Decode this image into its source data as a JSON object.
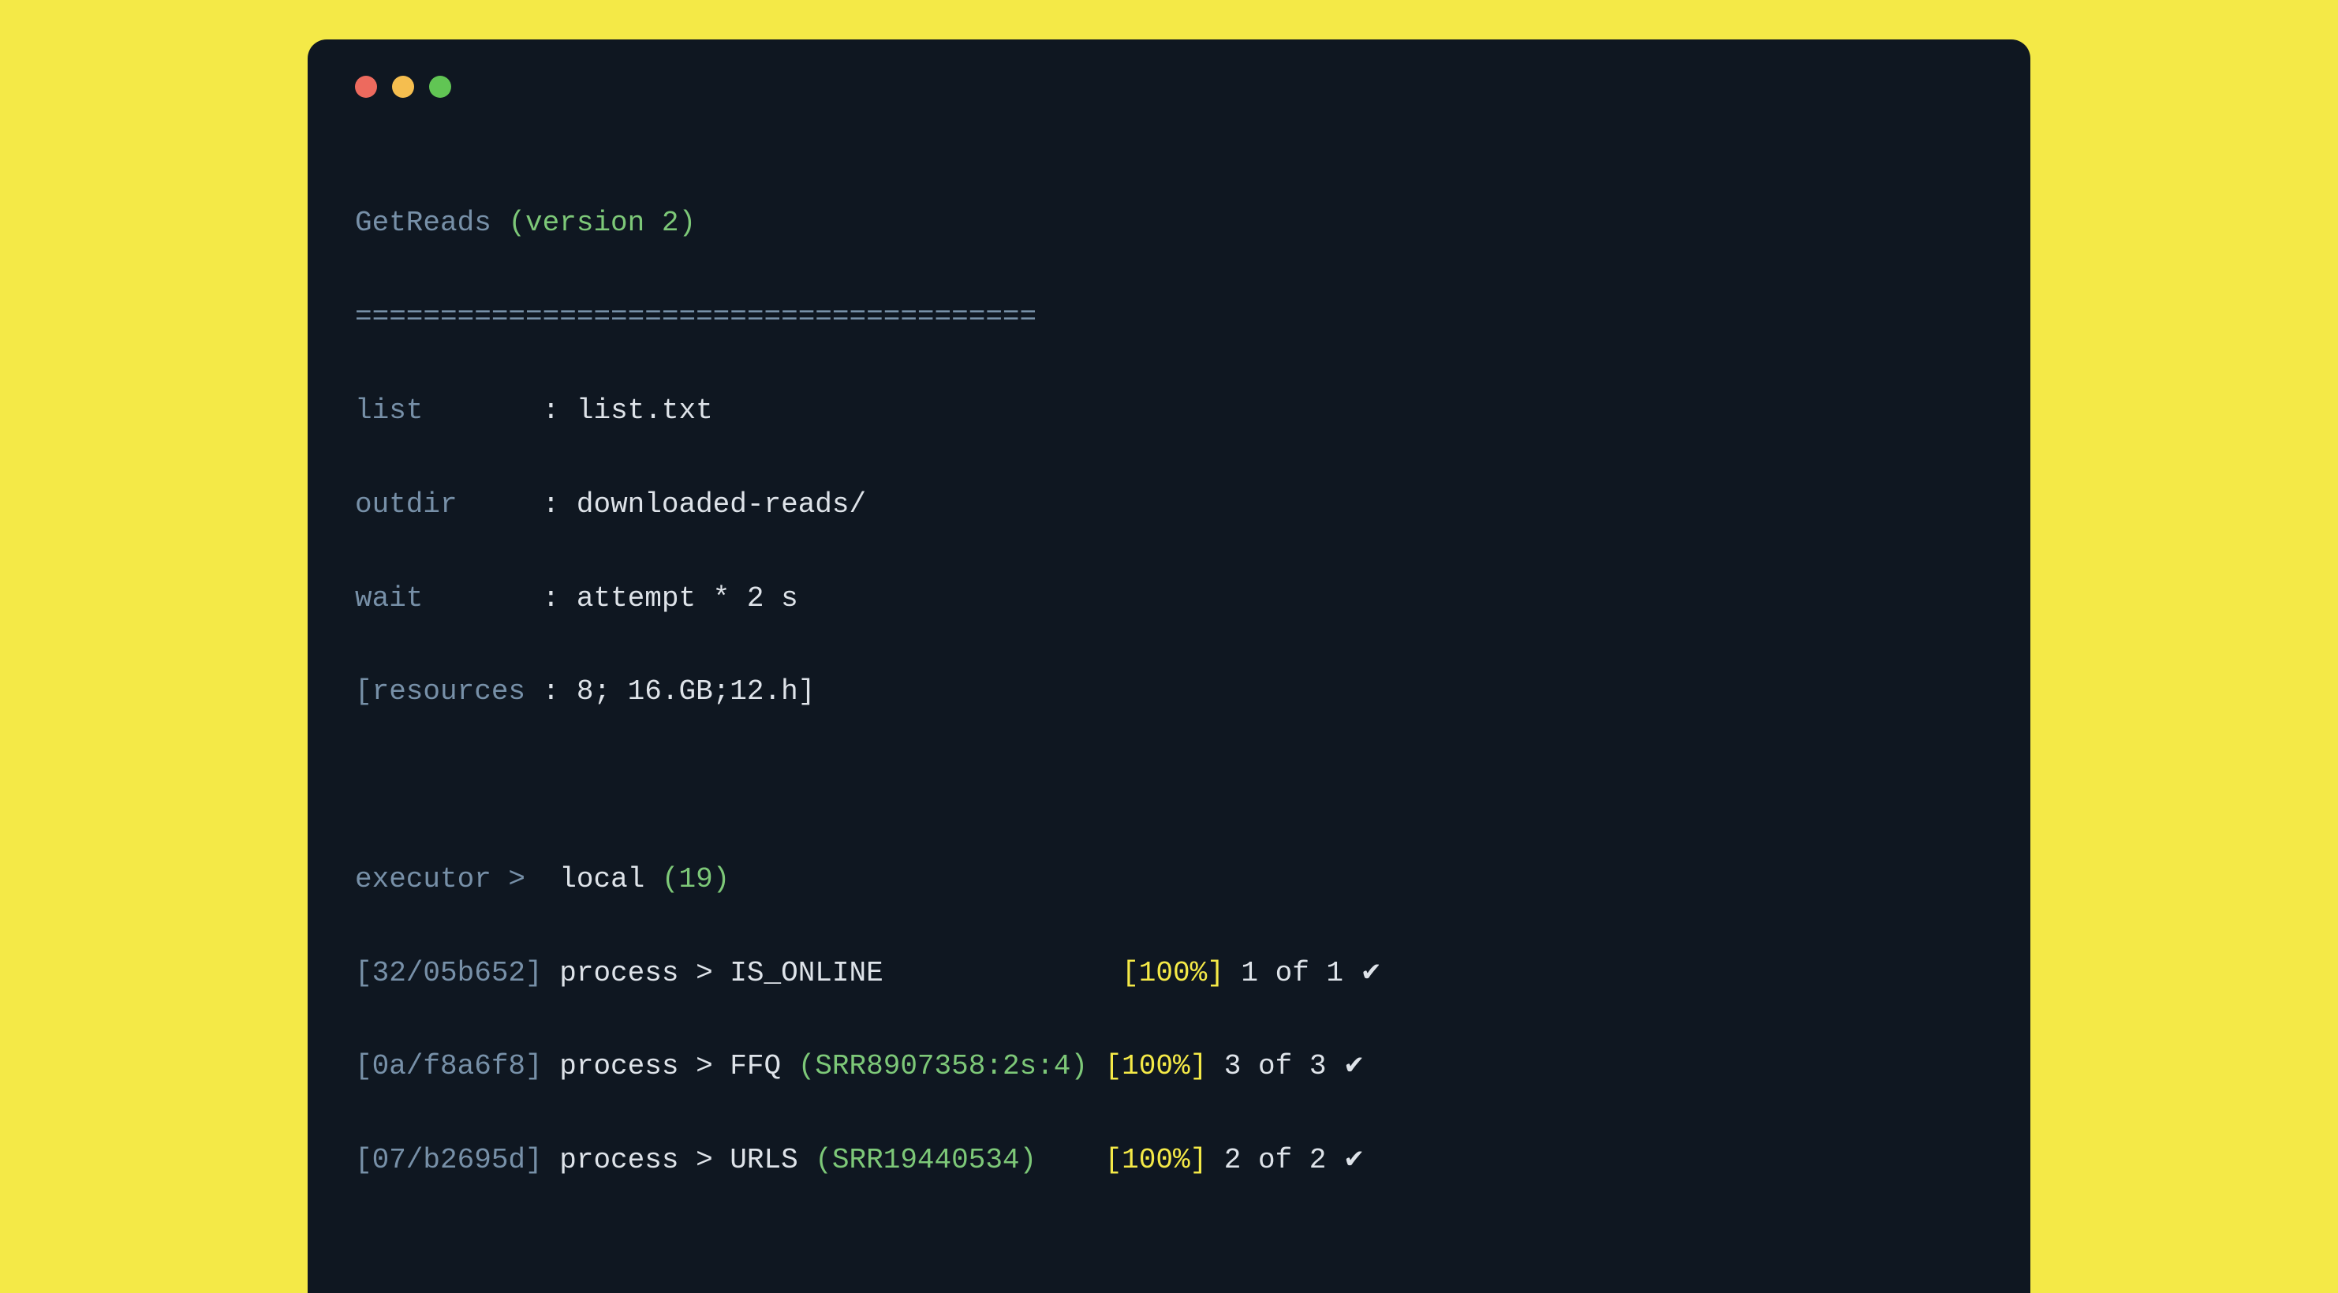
{
  "app": {
    "name": "GetReads",
    "version": "(version 2)"
  },
  "divider": "========================================",
  "params": {
    "list": {
      "key": "list      ",
      "val": " : list.txt"
    },
    "outdir": {
      "key": "outdir    ",
      "val": " : downloaded-reads/"
    },
    "wait": {
      "key": "wait      ",
      "val": " : attempt * 2 s"
    },
    "resources": {
      "key": "[resources",
      "val": " : 8; 16.GB;12.h]"
    }
  },
  "executor": {
    "key": "executor >",
    "val": "  local ",
    "count": "(19)"
  },
  "processes": [
    {
      "hash": "[32/05b652]",
      "proc": " process > IS_ONLINE              ",
      "sub": "",
      "pct": "[100%]",
      "count": " 1 of 1 ",
      "check": "✔"
    },
    {
      "hash": "[0a/f8a6f8]",
      "proc": " process > FFQ ",
      "sub": "(SRR8907358:2s:4) ",
      "pct": "[100%]",
      "count": " 3 of 3 ",
      "check": "✔"
    },
    {
      "hash": "[07/b2695d]",
      "proc": " process > URLS ",
      "sub": "(SRR19440534)    ",
      "pct": "[100%]",
      "count": " 2 of 2 ",
      "check": "✔"
    }
  ]
}
